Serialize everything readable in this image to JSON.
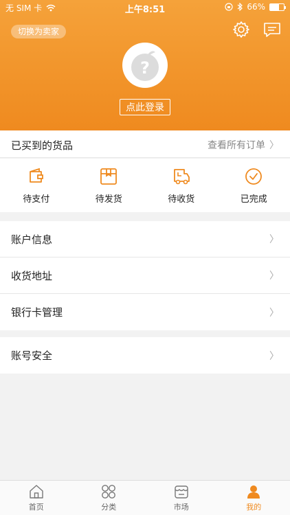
{
  "status_bar": {
    "carrier": "无 SIM 卡",
    "time": "上午8:51",
    "battery": "66%",
    "battery_level": 0.66
  },
  "header": {
    "switch_label": "切换为卖家",
    "login_label": "点此登录",
    "brand_color": "#ef8a1f",
    "icons": [
      "gear-icon",
      "message-icon",
      "avatar-icon"
    ]
  },
  "orders": {
    "title": "已买到的货品",
    "view_all": "查看所有订单",
    "items": [
      {
        "label": "待支付",
        "icon": "wallet-icon"
      },
      {
        "label": "待发货",
        "icon": "box-icon"
      },
      {
        "label": "待收货",
        "icon": "truck-icon"
      },
      {
        "label": "已完成",
        "icon": "check-circle-icon"
      }
    ]
  },
  "menu": {
    "group1": [
      {
        "label": "账户信息"
      },
      {
        "label": "收货地址"
      },
      {
        "label": "银行卡管理"
      }
    ],
    "group2": [
      {
        "label": "账号安全"
      }
    ]
  },
  "tabbar": {
    "tabs": [
      {
        "label": "首页",
        "icon": "home-icon"
      },
      {
        "label": "分类",
        "icon": "category-icon"
      },
      {
        "label": "市场",
        "icon": "market-icon"
      },
      {
        "label": "我的",
        "icon": "user-icon",
        "active": true
      }
    ]
  }
}
